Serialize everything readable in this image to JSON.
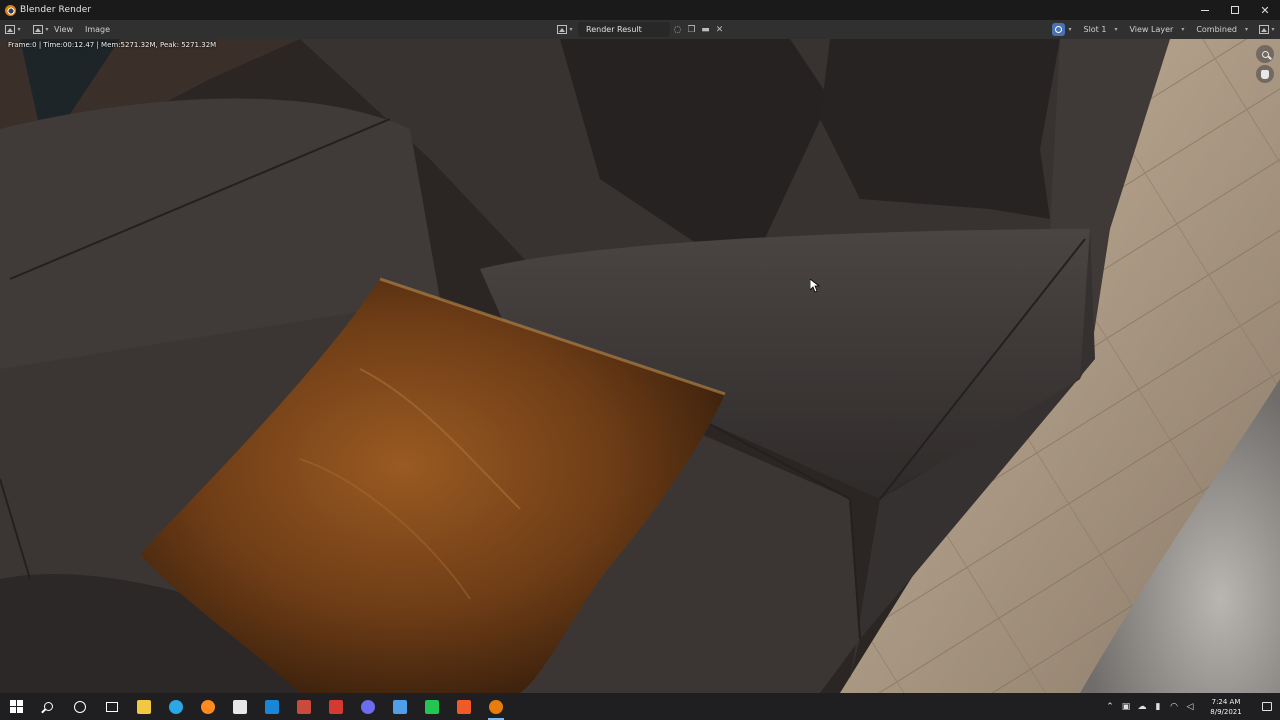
{
  "window": {
    "title": "Blender Render",
    "minimize_label": "",
    "close_label": "✕"
  },
  "header": {
    "menus": [
      "View",
      "Image"
    ],
    "render_slot_name": "Render Result",
    "slot": "Slot 1",
    "view_layer": "View Layer",
    "pass": "Combined"
  },
  "viewport": {
    "stats": "Frame:0 | Time:00:12.47 | Mem:5271.32M, Peak: 5271.32M"
  },
  "taskbar": {
    "apps": [
      {
        "icon": "file-explorer-icon",
        "color": "#f2c744"
      },
      {
        "icon": "edge-icon",
        "color": "#2aa7e4"
      },
      {
        "icon": "firefox-icon",
        "color": "#ff8a1f"
      },
      {
        "icon": "store-icon",
        "color": "#e8e8e8"
      },
      {
        "icon": "mail-icon",
        "color": "#1a86d8"
      },
      {
        "icon": "red-app-icon",
        "color": "#c84b3c"
      },
      {
        "icon": "red-app-2-icon",
        "color": "#d43a2f"
      },
      {
        "icon": "chrome-like-icon",
        "color": "#6b6cf0"
      },
      {
        "icon": "blue-doc-icon",
        "color": "#4fa0e8"
      },
      {
        "icon": "green-app-icon",
        "color": "#23c553"
      },
      {
        "icon": "orange-app-icon",
        "color": "#f05a28"
      },
      {
        "icon": "blender-icon",
        "color": "#e87d0d"
      }
    ],
    "time": "7:24 AM",
    "date": "8/9/2021"
  }
}
